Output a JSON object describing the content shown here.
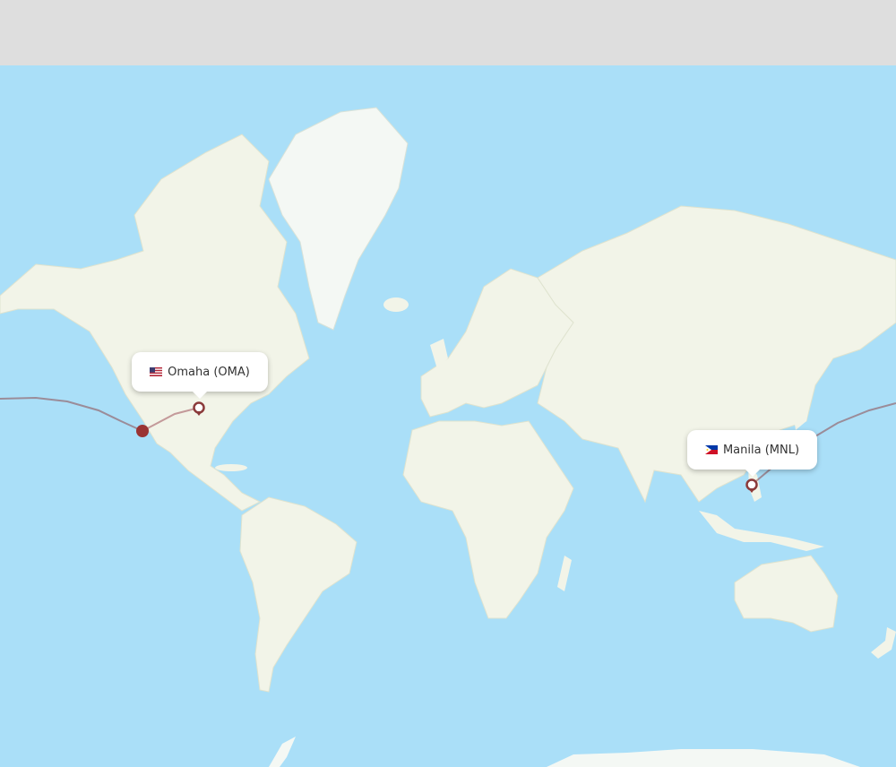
{
  "airports": {
    "origin": {
      "label": "Omaha (OMA)",
      "country_flag": "us-flag-icon"
    },
    "destination": {
      "label": "Manila (MNL)",
      "country_flag": "ph-flag-icon"
    }
  },
  "colors": {
    "water": "#aadff8",
    "land": "#f2f4e8",
    "ice": "#f4f8f4",
    "route": "#8b3a3a",
    "route_light": "#c49a9a",
    "marker": "#9a3333"
  }
}
